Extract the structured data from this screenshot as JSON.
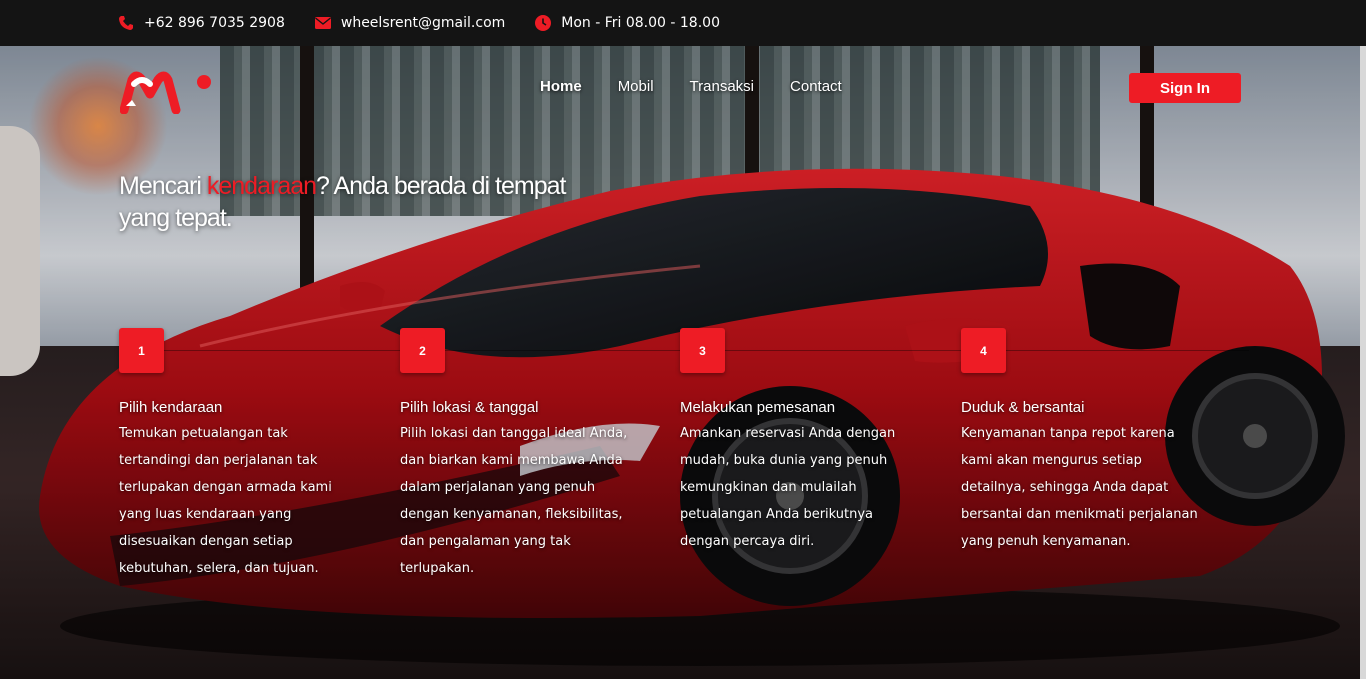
{
  "topbar": {
    "phone": "+62 896 7035 2908",
    "email": "wheelsrent@gmail.com",
    "hours": "Mon - Fri 08.00 - 18.00",
    "phone_icon": "phone-icon",
    "email_icon": "envelope-icon",
    "hours_icon": "clock-icon"
  },
  "nav": {
    "links": [
      "Home",
      "Mobil",
      "Transaksi",
      "Contact"
    ],
    "active": "Home",
    "signin_label": "Sign In"
  },
  "hero": {
    "headline_prefix": "Mencari ",
    "headline_accent": "kendaraan",
    "headline_suffix": "? Anda berada di tempat yang tepat."
  },
  "steps": [
    {
      "number": "1",
      "title": "Pilih kendaraan",
      "desc": "Temukan petualangan tak tertandingi dan perjalanan tak terlupakan dengan armada kami yang luas kendaraan yang disesuaikan dengan setiap kebutuhan, selera, dan tujuan."
    },
    {
      "number": "2",
      "title": "Pilih lokasi & tanggal",
      "desc": "Pilih lokasi dan tanggal ideal Anda, dan biarkan kami membawa Anda dalam perjalanan yang penuh dengan kenyamanan, fleksibilitas, dan pengalaman yang tak terlupakan."
    },
    {
      "number": "3",
      "title": "Melakukan pemesanan",
      "desc": "Amankan reservasi Anda dengan mudah, buka dunia yang penuh kemungkinan dan mulailah petualangan Anda berikutnya dengan percaya diri."
    },
    {
      "number": "4",
      "title": "Duduk & bersantai",
      "desc": "Kenyamanan tanpa repot karena kami akan mengurus setiap detailnya, sehingga Anda dapat bersantai dan menikmati perjalanan yang penuh kenyamanan."
    }
  ],
  "colors": {
    "accent": "#ee1c25",
    "topbar_bg": "#141414"
  }
}
